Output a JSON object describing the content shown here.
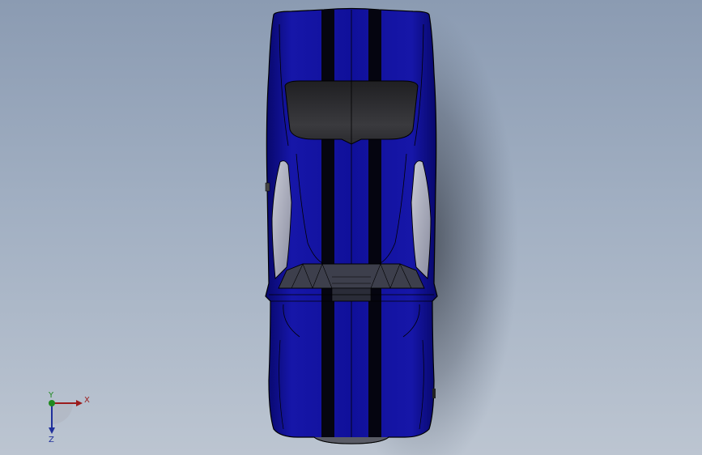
{
  "viewport": {
    "background_top": "#8b9bb2",
    "background_bottom": "#bcc5d1"
  },
  "model": {
    "body_color": "#0e0e8c",
    "stripe_color": "#050510",
    "glass_color": "#2f2f33",
    "outline_color": "#000000"
  },
  "triad": {
    "x_label": "X",
    "y_label": "Y",
    "z_label": "Z",
    "x_color": "#9b1c1c",
    "y_color": "#1f8a1f",
    "z_color": "#1f2f9b"
  }
}
